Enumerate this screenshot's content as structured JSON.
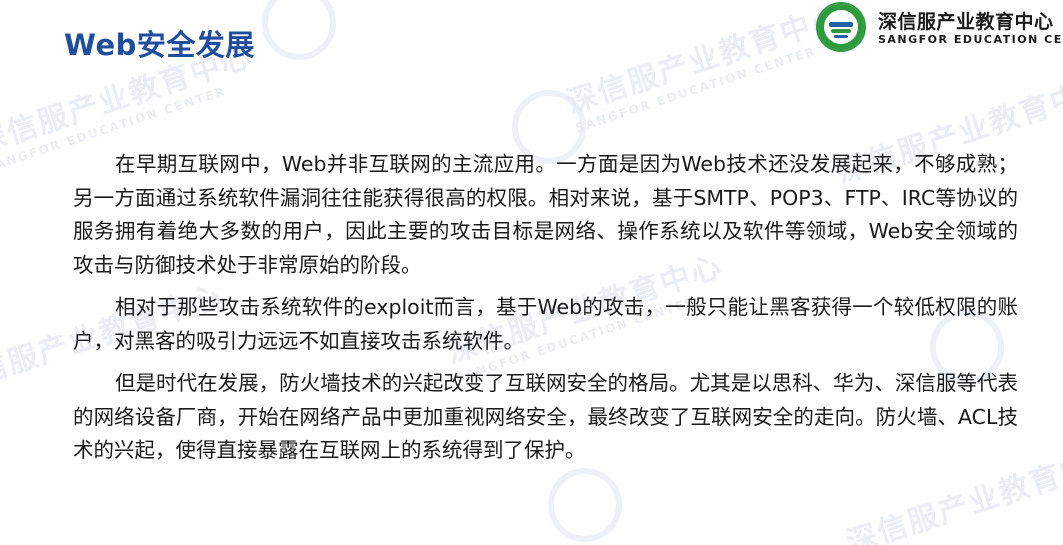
{
  "header": {
    "title": "Web安全发展"
  },
  "logo": {
    "name_cn": "深信服产业教育中心",
    "name_en": "SANGFOR EDUCATION CENTER",
    "badge_icon": "sangfor-education-badge-icon"
  },
  "watermark": {
    "text_cn": "深信服产业教育中心",
    "text_en": "SANGFOR EDUCATION CENTER"
  },
  "content": {
    "paragraphs": [
      "在早期互联网中，Web并非互联网的主流应用。一方面是因为Web技术还没发展起来，不够成熟；另一方面通过系统软件漏洞往往能获得很高的权限。相对来说，基于SMTP、POP3、FTP、IRC等协议的服务拥有着绝大多数的用户，因此主要的攻击目标是网络、操作系统以及软件等领域，Web安全领域的攻击与防御技术处于非常原始的阶段。",
      "相对于那些攻击系统软件的exploit而言，基于Web的攻击，一般只能让黑客获得一个较低权限的账户，对黑客的吸引力远远不如直接攻击系统软件。",
      "但是时代在发展，防火墙技术的兴起改变了互联网安全的格局。尤其是以思科、华为、深信服等代表的网络设备厂商，开始在网络产品中更加重视网络安全，最终改变了互联网安全的走向。防火墙、ACL技术的兴起，使得直接暴露在互联网上的系统得到了保护。"
    ]
  },
  "colors": {
    "title": "#1f4e9c",
    "text": "#1a1a1a",
    "badge_green": "#2e9a3e",
    "badge_blue": "#1f5fa8"
  }
}
